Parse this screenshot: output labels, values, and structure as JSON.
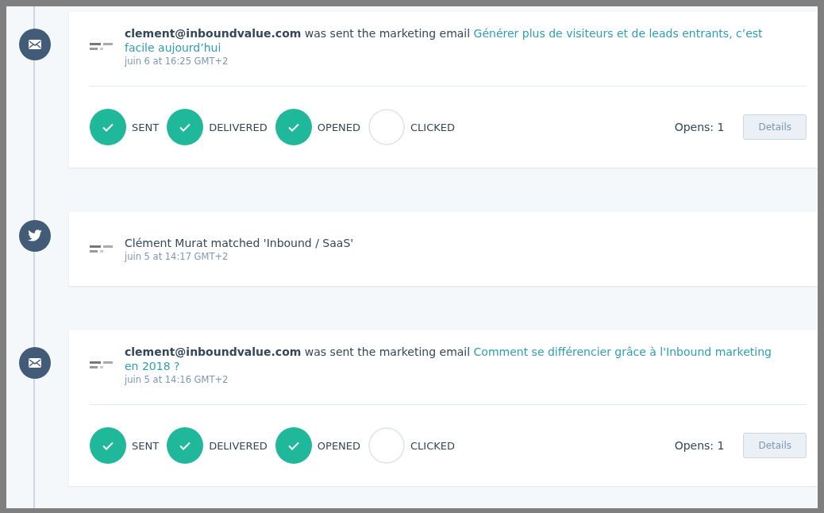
{
  "events": [
    {
      "kind": "email",
      "sentence": "**clement@inboundvalue.com** was sent the marketing email ",
      "link": "Générer plus de visiteurs et de leads entrants, c’est facile aujourd’hui",
      "time": "juin 6 at 16:25 GMT+2",
      "steps": [
        {
          "label": "SENT",
          "done": true
        },
        {
          "label": "DELIVERED",
          "done": true
        },
        {
          "label": "OPENED",
          "done": true
        },
        {
          "label": "CLICKED",
          "done": false
        }
      ],
      "opens": "Opens: 1",
      "button": "Details"
    },
    {
      "kind": "twitter",
      "sentence": "Clément Murat matched 'Inbound / SaaS'",
      "time": "juin 5 at 14:17 GMT+2"
    },
    {
      "kind": "email",
      "sentence": "**clement@inboundvalue.com** was sent the marketing email ",
      "link": "Comment se différencier grâce à l'Inbound marketing en 2018 ?",
      "time": "juin 5 at 14:16 GMT+2",
      "steps": [
        {
          "label": "SENT",
          "done": true
        },
        {
          "label": "DELIVERED",
          "done": true
        },
        {
          "label": "OPENED",
          "done": true
        },
        {
          "label": "CLICKED",
          "done": false
        }
      ],
      "opens": "Opens: 1",
      "button": "Details"
    }
  ]
}
